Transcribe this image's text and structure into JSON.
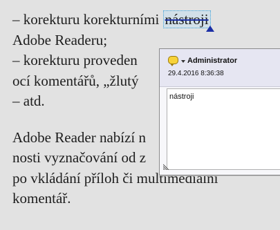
{
  "document": {
    "line1_before": "– korekturu korekturními ",
    "line1_struck": "nástroji",
    "line2": "Adobe Readeru;",
    "line3": "– korekturu proveden",
    "line4": "ocí komentářů, „žlutý",
    "line5": "– atd.",
    "line6": "Adobe Reader nabízí n",
    "line7": "nosti vyznačování od z",
    "line8": "po vkládání příloh či multimediální",
    "line9": "komentář."
  },
  "comment_popup": {
    "author": "Administrator",
    "date": "29.4.2016 8:36:38",
    "text": "nástroji"
  }
}
